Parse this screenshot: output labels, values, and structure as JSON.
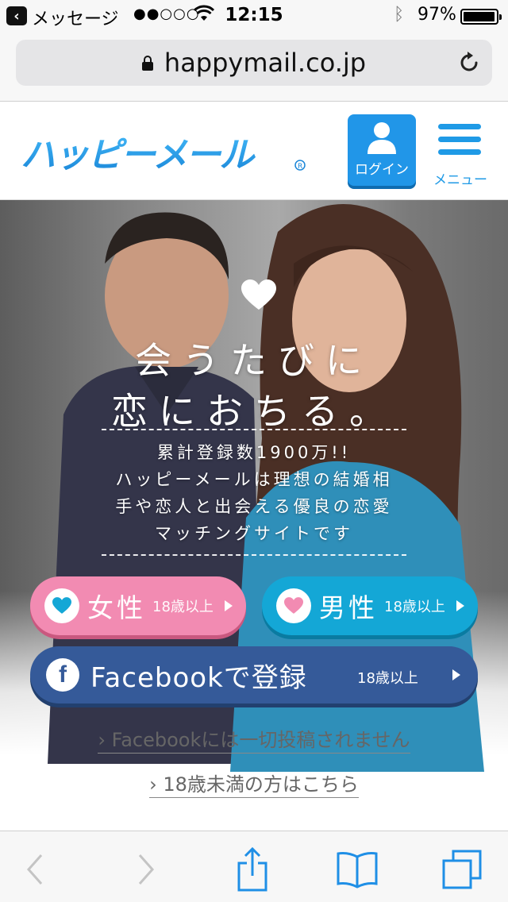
{
  "status_bar": {
    "back_app": "メッセージ",
    "signal": "●●○○○",
    "time": "12:15",
    "battery_percent": "97%",
    "battery_level": 0.97
  },
  "browser": {
    "url": "happymail.co.jp"
  },
  "header": {
    "logo_text": "ハッピーメール",
    "login_label": "ログイン",
    "menu_label": "メニュー"
  },
  "hero": {
    "headline_line1": "会うたびに",
    "headline_line2": "恋におちる。",
    "description": [
      "累計登録数1900万!!",
      "ハッピーメールは理想の結婚相",
      "手や恋人と出会える優良の恋愛",
      "マッチングサイトです"
    ]
  },
  "signup": {
    "female_label": "女性",
    "female_age": "18歳以上",
    "male_label": "男性",
    "male_age": "18歳以上",
    "facebook_label": "Facebookで登録",
    "facebook_age": "18歳以上"
  },
  "links": {
    "facebook_notice": "› Facebookには一切投稿されません",
    "under18": "› 18歳未満の方はこちら"
  },
  "colors": {
    "brand_blue": "#2196e8",
    "female_pink": "#f28bb2",
    "male_cyan": "#14a7d6",
    "facebook_navy": "#355a99",
    "safari_blue": "#1f8fe6"
  }
}
